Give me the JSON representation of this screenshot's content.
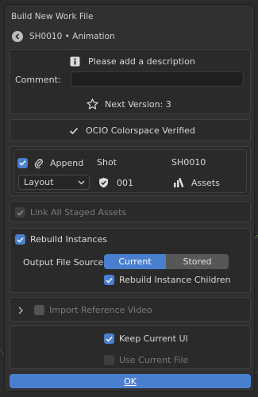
{
  "dialog": {
    "title": "Build New Work File",
    "subtitle": "SH0010 • Animation"
  },
  "description": {
    "notice": "Please add a description",
    "comment_label": "Comment:",
    "comment_value": "",
    "next_version": "Next Version: 3"
  },
  "ocio": {
    "label": "OCIO Colorspace Verified"
  },
  "work": {
    "append_label": "Append",
    "append_checked": true,
    "shot_label": "Shot",
    "shot_value": "SH0010",
    "task_dropdown": "Layout",
    "version_value": "001",
    "assets_label": "Assets"
  },
  "link_staged": {
    "label": "Link All Staged Assets",
    "checked": true,
    "enabled": false
  },
  "rebuild": {
    "label": "Rebuild Instances",
    "checked": true,
    "source_label": "Output File Source",
    "options": [
      "Current",
      "Stored"
    ],
    "selected": "Current",
    "children_label": "Rebuild Instance Children",
    "children_checked": true
  },
  "import_ref": {
    "label": "Import Reference Video",
    "checked": false
  },
  "ui": {
    "keep_label": "Keep Current UI",
    "keep_checked": true,
    "use_file_label": "Use Current File",
    "use_file_checked": false
  },
  "ok_label": "OK",
  "colors": {
    "accent": "#4a7fcf",
    "panel": "#303030",
    "box": "#2a2a2a"
  }
}
